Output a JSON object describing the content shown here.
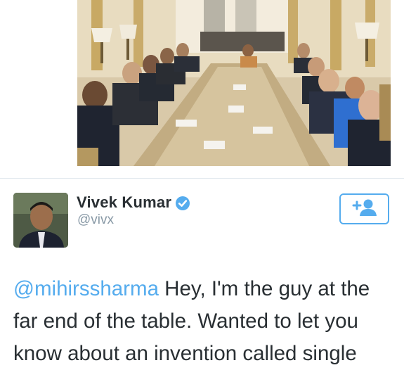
{
  "tweet": {
    "author_name": "Vivek Kumar",
    "author_handle": "@vivx",
    "mention": "@mihirssharma",
    "text_line1_rest": " Hey, I'm the guy at the",
    "text_line2": "far end of the table. Wanted to let you",
    "text_line3": "know about an invention called single"
  },
  "icons": {
    "verified": "verified-badge-icon",
    "follow": "add-user-icon"
  },
  "colors": {
    "accent": "#55acee",
    "text": "#292f33",
    "muted": "#8899a6"
  }
}
